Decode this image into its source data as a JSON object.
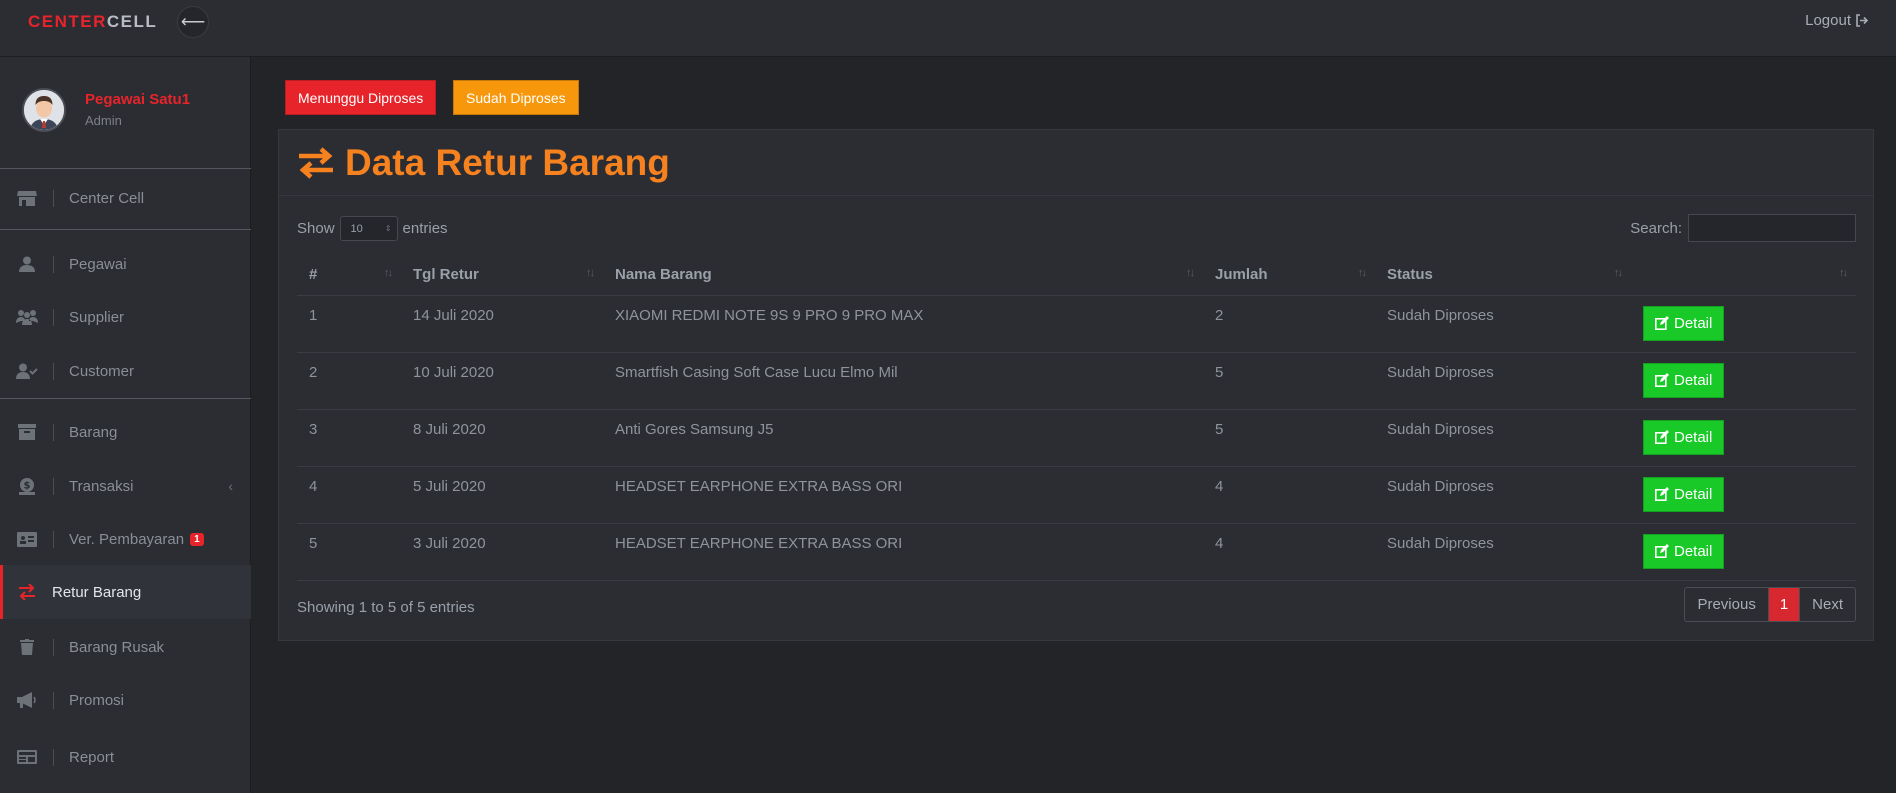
{
  "topbar": {
    "brand_part1": "CENTER",
    "brand_part2": "CELL",
    "logout_label": "Logout"
  },
  "profile": {
    "name": "Pegawai Satu1",
    "role": "Admin"
  },
  "sidebar": {
    "items": [
      {
        "label": "Center Cell",
        "icon": "store-icon"
      },
      {
        "label": "Pegawai",
        "icon": "user-icon"
      },
      {
        "label": "Supplier",
        "icon": "users-icon"
      },
      {
        "label": "Customer",
        "icon": "user-check-icon"
      },
      {
        "label": "Barang",
        "icon": "archive-icon"
      },
      {
        "label": "Transaksi",
        "icon": "money-icon"
      },
      {
        "label": "Ver. Pembayaran",
        "icon": "id-card-icon",
        "badge": "1"
      },
      {
        "label": "Retur Barang",
        "icon": "exchange-icon",
        "active": true
      },
      {
        "label": "Barang Rusak",
        "icon": "trash-icon"
      },
      {
        "label": "Promosi",
        "icon": "megaphone-icon"
      },
      {
        "label": "Report",
        "icon": "report-icon"
      }
    ]
  },
  "filters": {
    "waiting_label": "Menunggu Diproses",
    "done_label": "Sudah Diproses"
  },
  "card": {
    "title": "Data Retur Barang"
  },
  "table_controls": {
    "show_label": "Show",
    "page_size": "10",
    "entries_label": "entries",
    "search_label": "Search:"
  },
  "table": {
    "columns": [
      "#",
      "Tgl Retur",
      "Nama Barang",
      "Jumlah",
      "Status",
      ""
    ],
    "rows": [
      {
        "no": "1",
        "date": "14 Juli 2020",
        "name": "XIAOMI REDMI NOTE 9S 9 PRO 9 PRO MAX",
        "qty": "2",
        "status": "Sudah Diproses",
        "action": "Detail"
      },
      {
        "no": "2",
        "date": "10 Juli 2020",
        "name": "Smartfish Casing Soft Case Lucu Elmo Mil",
        "qty": "5",
        "status": "Sudah Diproses",
        "action": "Detail"
      },
      {
        "no": "3",
        "date": "8 Juli 2020",
        "name": "Anti Gores Samsung J5",
        "qty": "5",
        "status": "Sudah Diproses",
        "action": "Detail"
      },
      {
        "no": "4",
        "date": "5 Juli 2020",
        "name": "HEADSET EARPHONE EXTRA BASS ORI",
        "qty": "4",
        "status": "Sudah Diproses",
        "action": "Detail"
      },
      {
        "no": "5",
        "date": "3 Juli 2020",
        "name": "HEADSET EARPHONE EXTRA BASS ORI",
        "qty": "4",
        "status": "Sudah Diproses",
        "action": "Detail"
      }
    ]
  },
  "footer": {
    "showing": "Showing 1 to 5 of 5 entries",
    "prev_label": "Previous",
    "current_page": "1",
    "next_label": "Next"
  },
  "colors": {
    "accent_red": "#e8242b",
    "accent_orange": "#f6811f",
    "success_green": "#19c928",
    "bg_dark": "#222428",
    "panel": "#2b2d33"
  }
}
